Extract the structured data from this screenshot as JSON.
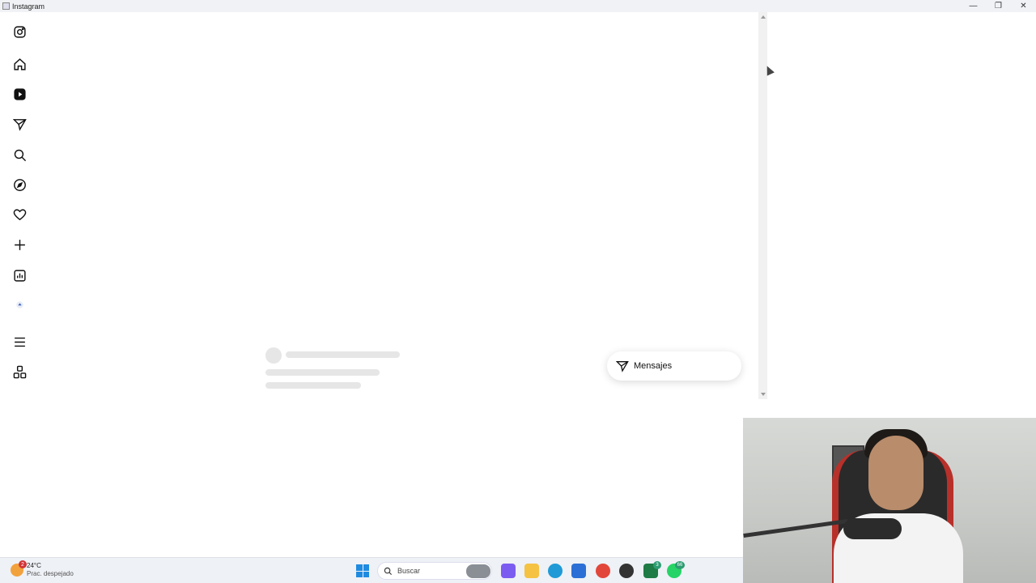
{
  "window": {
    "title": "Instagram",
    "controls": [
      "—",
      "❐",
      "✕"
    ]
  },
  "sidebar": {
    "items": [
      {
        "name": "instagram-logo-icon"
      },
      {
        "name": "home-icon"
      },
      {
        "name": "reels-icon"
      },
      {
        "name": "messages-icon"
      },
      {
        "name": "search-icon"
      },
      {
        "name": "explore-icon"
      },
      {
        "name": "notifications-heart-icon"
      },
      {
        "name": "create-plus-icon"
      },
      {
        "name": "dashboard-chart-icon"
      },
      {
        "name": "profile-avatar-icon"
      },
      {
        "name": "more-menu-icon"
      },
      {
        "name": "also-from-meta-icon"
      }
    ]
  },
  "messages_button": {
    "label": "Mensajes"
  },
  "taskbar": {
    "weather": {
      "temp": "24°C",
      "condition": "Prac. despejado",
      "badge": "2"
    },
    "search_placeholder": "Buscar",
    "apps": [
      {
        "name": "copilot-icon",
        "color": "#7b5cf0"
      },
      {
        "name": "file-explorer-icon",
        "color": "#f5c242"
      },
      {
        "name": "edge-icon",
        "color": "#1f9ad6"
      },
      {
        "name": "store-icon",
        "color": "#2b6fd6"
      },
      {
        "name": "chrome-icon",
        "color": "#e2463a"
      },
      {
        "name": "instagram-app-icon",
        "color": "#333333"
      },
      {
        "name": "excel-icon",
        "color": "#1e7b45",
        "badge": "3"
      },
      {
        "name": "whatsapp-icon",
        "color": "#25d366",
        "badge": "66"
      }
    ]
  }
}
